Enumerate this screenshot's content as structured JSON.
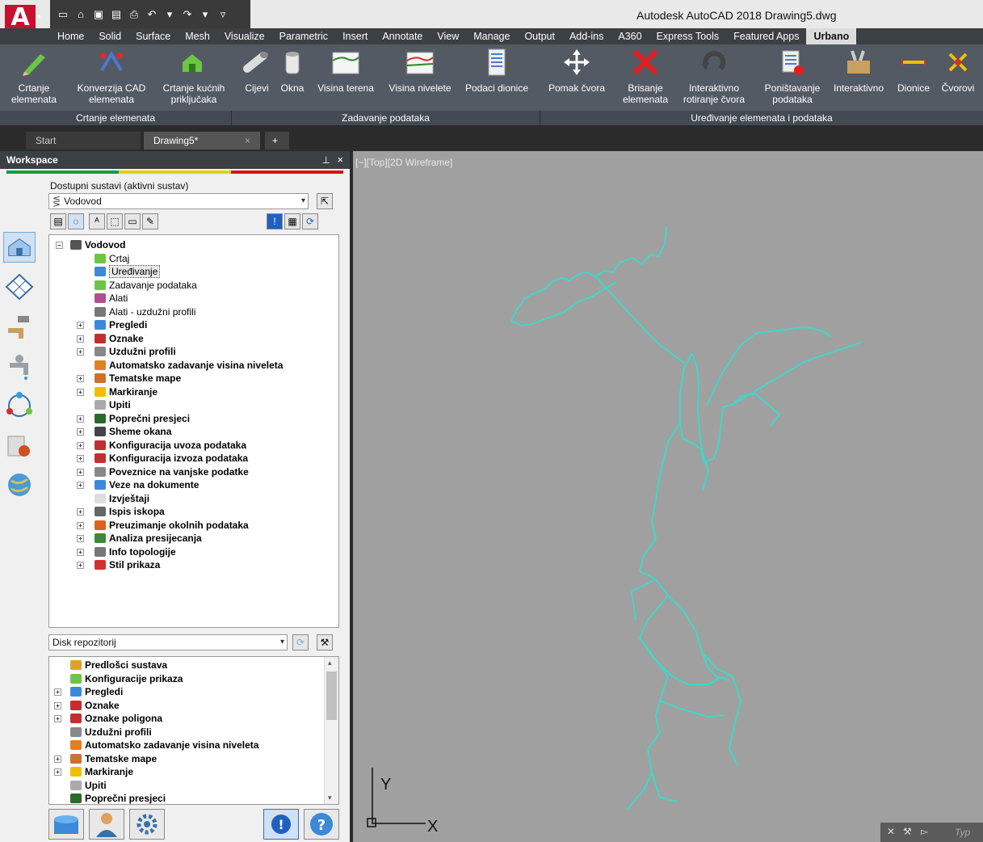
{
  "title_bar": {
    "title": "Autodesk AutoCAD 2018   Drawing5.dwg",
    "app_letter": "A"
  },
  "quick_access": [
    "new",
    "open",
    "save",
    "save-as",
    "print",
    "undo",
    "redo"
  ],
  "ribbon_tabs": [
    "Home",
    "Solid",
    "Surface",
    "Mesh",
    "Visualize",
    "Parametric",
    "Insert",
    "Annotate",
    "View",
    "Manage",
    "Output",
    "Add-ins",
    "A360",
    "Express Tools",
    "Featured Apps",
    "Urbano"
  ],
  "active_ribbon_tab": "Urbano",
  "ribbon": {
    "crtanje_elemenata": "Crtanje\nelemenata",
    "konverzija": "Konverzija CAD\nelemenata",
    "crtanje_kucnih": "Crtanje kućnih\npriključaka",
    "cijevi": "Cijevi",
    "okna": "Okna",
    "visina_terena": "Visina terena",
    "visina_nivelete": "Visina nivelete",
    "podaci_dionice": "Podaci dionice",
    "pomak_cvora": "Pomak čvora",
    "brisanje": "Brisanje\nelemenata",
    "interaktivno_rot": "Interaktivno\nrotiranje čvora",
    "ponistavanje": "Poništavanje\npodataka",
    "interaktivno": "Interaktivno",
    "dionice": "Dionice",
    "cvorovi": "Čvorovi"
  },
  "panels": {
    "p1": "Crtanje elemenata",
    "p2": "Zadavanje podataka",
    "p3": "Uređivanje elemenata i podataka"
  },
  "doc_tabs": {
    "start": "Start",
    "drawing": "Drawing5*",
    "close": "×",
    "add": "+"
  },
  "workspace": {
    "title": "Workspace",
    "pin": "ᵖ",
    "close": "×",
    "bar_colors": [
      "#11a040",
      "#e0d000",
      "#e01010"
    ],
    "systems_label": "Dostupni sustavi (aktivni sustav)",
    "systems_value": "Vodovod",
    "repo_value": "Disk repozitorij"
  },
  "tree1": [
    {
      "label": "Vodovod",
      "bold": true,
      "level": 0,
      "exp": "−",
      "icon": "vodovod"
    },
    {
      "label": "Crtaj",
      "bold": false,
      "level": 1,
      "icon": "pencil"
    },
    {
      "label": "Uređivanje",
      "bold": false,
      "level": 1,
      "icon": "edit",
      "selected": true
    },
    {
      "label": "Zadavanje podataka",
      "bold": false,
      "level": 1,
      "icon": "data"
    },
    {
      "label": "Alati",
      "bold": false,
      "level": 1,
      "icon": "tools"
    },
    {
      "label": "Alati - uzdužni profili",
      "bold": false,
      "level": 1,
      "icon": "tools2"
    },
    {
      "label": "Pregledi",
      "bold": true,
      "level": 1,
      "exp": "+",
      "icon": "grid"
    },
    {
      "label": "Oznake",
      "bold": true,
      "level": 1,
      "exp": "+",
      "icon": "flag"
    },
    {
      "label": "Uzdužni profili",
      "bold": true,
      "level": 1,
      "exp": "+",
      "icon": "profile"
    },
    {
      "label": "Automatsko zadavanje visina niveleta",
      "bold": true,
      "level": 1,
      "icon": "auto"
    },
    {
      "label": "Tematske mape",
      "bold": true,
      "level": 1,
      "exp": "+",
      "icon": "map"
    },
    {
      "label": "Markiranje",
      "bold": true,
      "level": 1,
      "exp": "+",
      "icon": "marker"
    },
    {
      "label": "Upiti",
      "bold": true,
      "level": 1,
      "icon": "funnel"
    },
    {
      "label": "Poprečni presjeci",
      "bold": true,
      "level": 1,
      "exp": "+",
      "icon": "section"
    },
    {
      "label": "Sheme okana",
      "bold": true,
      "level": 1,
      "exp": "+",
      "icon": "scheme"
    },
    {
      "label": "Konfiguracija uvoza podataka",
      "bold": true,
      "level": 1,
      "exp": "+",
      "icon": "import"
    },
    {
      "label": "Konfiguracija izvoza podataka",
      "bold": true,
      "level": 1,
      "exp": "+",
      "icon": "export"
    },
    {
      "label": "Poveznice na vanjske podatke",
      "bold": true,
      "level": 1,
      "exp": "+",
      "icon": "link"
    },
    {
      "label": "Veze na dokumente",
      "bold": true,
      "level": 1,
      "exp": "+",
      "icon": "doc"
    },
    {
      "label": "Izvještaji",
      "bold": true,
      "level": 1,
      "icon": "report"
    },
    {
      "label": "Ispis iskopa",
      "bold": true,
      "level": 1,
      "exp": "+",
      "icon": "dig"
    },
    {
      "label": "Preuzimanje okolnih podataka",
      "bold": true,
      "level": 1,
      "exp": "+",
      "icon": "download"
    },
    {
      "label": "Analiza presijecanja",
      "bold": true,
      "level": 1,
      "exp": "+",
      "icon": "analysis"
    },
    {
      "label": "Info topologije",
      "bold": true,
      "level": 1,
      "exp": "+",
      "icon": "info"
    },
    {
      "label": "Stil prikaza",
      "bold": true,
      "level": 1,
      "exp": "+",
      "icon": "style"
    }
  ],
  "tree2": [
    {
      "label": "Predlošci sustava",
      "bold": true,
      "exp": "",
      "icon": "template"
    },
    {
      "label": "Konfiguracije prikaza",
      "bold": true,
      "exp": "",
      "icon": "pencil"
    },
    {
      "label": "Pregledi",
      "bold": true,
      "exp": "+",
      "icon": "grid"
    },
    {
      "label": "Oznake",
      "bold": true,
      "exp": "+",
      "icon": "flag"
    },
    {
      "label": "Oznake poligona",
      "bold": true,
      "exp": "+",
      "icon": "flag"
    },
    {
      "label": "Uzdužni profili",
      "bold": true,
      "exp": "",
      "icon": "profile"
    },
    {
      "label": "Automatsko zadavanje visina niveleta",
      "bold": true,
      "exp": "",
      "icon": "auto"
    },
    {
      "label": "Tematske mape",
      "bold": true,
      "exp": "+",
      "icon": "map"
    },
    {
      "label": "Markiranje",
      "bold": true,
      "exp": "+",
      "icon": "marker"
    },
    {
      "label": "Upiti",
      "bold": true,
      "exp": "",
      "icon": "funnel"
    },
    {
      "label": "Poprečni presjeci",
      "bold": true,
      "exp": "",
      "icon": "section"
    }
  ],
  "viewport": {
    "label": "[−][Top][2D Wireframe]",
    "axis_x": "X",
    "axis_y": "Y",
    "pipe_color": "#3fd8c8",
    "cmd_hint": "Typ"
  }
}
